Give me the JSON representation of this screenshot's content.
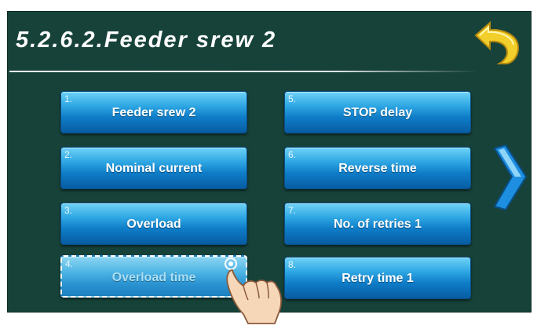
{
  "header": {
    "title": "5.2.6.2.Feeder srew 2"
  },
  "nav": {
    "back_icon": "back-arrow-icon",
    "next_icon": "chevron-right-icon"
  },
  "menu": {
    "left": [
      {
        "number": "1.",
        "label": "Feeder srew 2"
      },
      {
        "number": "2.",
        "label": "Nominal current"
      },
      {
        "number": "3.",
        "label": "Overload"
      },
      {
        "number": "4.",
        "label": "Overload time",
        "selected": true
      }
    ],
    "right": [
      {
        "number": "5.",
        "label": "STOP delay"
      },
      {
        "number": "6.",
        "label": "Reverse time"
      },
      {
        "number": "7.",
        "label": "No. of retries 1"
      },
      {
        "number": "8.",
        "label": "Retry time 1"
      }
    ]
  },
  "colors": {
    "background": "#17423a",
    "button": "#0f7dc8",
    "back_arrow": "#f2cf2a",
    "next_arrow": "#1e8fe0"
  }
}
